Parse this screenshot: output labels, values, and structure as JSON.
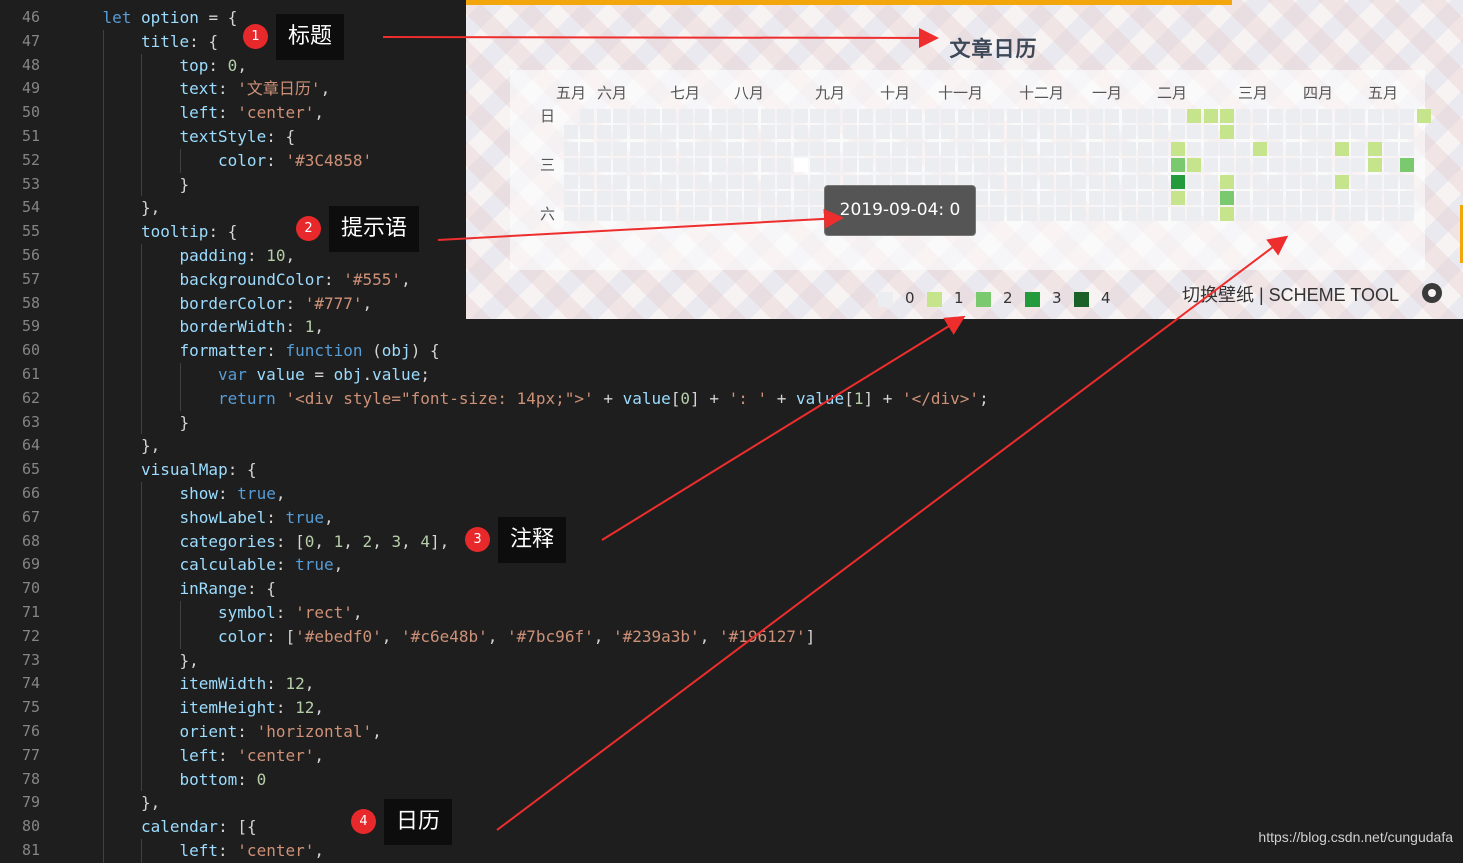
{
  "editor": {
    "lines": [
      {
        "n": "46",
        "indent": 1,
        "tokens": [
          [
            "kw",
            "let "
          ],
          [
            "var",
            "option"
          ],
          [
            "plain",
            " = {"
          ]
        ]
      },
      {
        "n": "47",
        "indent": 2,
        "tokens": [
          [
            "prop",
            "title"
          ],
          [
            "plain",
            ": {"
          ]
        ]
      },
      {
        "n": "48",
        "indent": 3,
        "tokens": [
          [
            "prop",
            "top"
          ],
          [
            "plain",
            ": "
          ],
          [
            "num",
            "0"
          ],
          [
            "plain",
            ","
          ]
        ]
      },
      {
        "n": "49",
        "indent": 3,
        "tokens": [
          [
            "prop",
            "text"
          ],
          [
            "plain",
            ": "
          ],
          [
            "str",
            "'文章日历'"
          ],
          [
            "plain",
            ","
          ]
        ]
      },
      {
        "n": "50",
        "indent": 3,
        "tokens": [
          [
            "prop",
            "left"
          ],
          [
            "plain",
            ": "
          ],
          [
            "str",
            "'center'"
          ],
          [
            "plain",
            ","
          ]
        ]
      },
      {
        "n": "51",
        "indent": 3,
        "tokens": [
          [
            "prop",
            "textStyle"
          ],
          [
            "plain",
            ": {"
          ]
        ]
      },
      {
        "n": "52",
        "indent": 4,
        "tokens": [
          [
            "prop",
            "color"
          ],
          [
            "plain",
            ": "
          ],
          [
            "str",
            "'#3C4858'"
          ]
        ]
      },
      {
        "n": "53",
        "indent": 3,
        "tokens": [
          [
            "plain",
            "}"
          ]
        ]
      },
      {
        "n": "54",
        "indent": 2,
        "tokens": [
          [
            "plain",
            "},"
          ]
        ]
      },
      {
        "n": "55",
        "indent": 2,
        "tokens": [
          [
            "prop",
            "tooltip"
          ],
          [
            "plain",
            ": {"
          ]
        ]
      },
      {
        "n": "56",
        "indent": 3,
        "tokens": [
          [
            "prop",
            "padding"
          ],
          [
            "plain",
            ": "
          ],
          [
            "num",
            "10"
          ],
          [
            "plain",
            ","
          ]
        ]
      },
      {
        "n": "57",
        "indent": 3,
        "tokens": [
          [
            "prop",
            "backgroundColor"
          ],
          [
            "plain",
            ": "
          ],
          [
            "str",
            "'#555'"
          ],
          [
            "plain",
            ","
          ]
        ]
      },
      {
        "n": "58",
        "indent": 3,
        "tokens": [
          [
            "prop",
            "borderColor"
          ],
          [
            "plain",
            ": "
          ],
          [
            "str",
            "'#777'"
          ],
          [
            "plain",
            ","
          ]
        ]
      },
      {
        "n": "59",
        "indent": 3,
        "tokens": [
          [
            "prop",
            "borderWidth"
          ],
          [
            "plain",
            ": "
          ],
          [
            "num",
            "1"
          ],
          [
            "plain",
            ","
          ]
        ]
      },
      {
        "n": "60",
        "indent": 3,
        "tokens": [
          [
            "prop",
            "formatter"
          ],
          [
            "plain",
            ": "
          ],
          [
            "kw",
            "function"
          ],
          [
            "plain",
            " ("
          ],
          [
            "var",
            "obj"
          ],
          [
            "plain",
            ") {"
          ]
        ]
      },
      {
        "n": "61",
        "indent": 4,
        "tokens": [
          [
            "kw",
            "var "
          ],
          [
            "var",
            "value"
          ],
          [
            "plain",
            " = "
          ],
          [
            "var",
            "obj"
          ],
          [
            "plain",
            "."
          ],
          [
            "var",
            "value"
          ],
          [
            "plain",
            ";"
          ]
        ]
      },
      {
        "n": "62",
        "indent": 4,
        "tokens": [
          [
            "kw",
            "return "
          ],
          [
            "str",
            "'<div style=\"font-size: 14px;\">'"
          ],
          [
            "plain",
            " + "
          ],
          [
            "var",
            "value"
          ],
          [
            "plain",
            "["
          ],
          [
            "num",
            "0"
          ],
          [
            "plain",
            "] + "
          ],
          [
            "str",
            "': '"
          ],
          [
            "plain",
            " + "
          ],
          [
            "var",
            "value"
          ],
          [
            "plain",
            "["
          ],
          [
            "num",
            "1"
          ],
          [
            "plain",
            "] + "
          ],
          [
            "str",
            "'</div>'"
          ],
          [
            "plain",
            ";"
          ]
        ]
      },
      {
        "n": "63",
        "indent": 3,
        "tokens": [
          [
            "plain",
            "}"
          ]
        ]
      },
      {
        "n": "64",
        "indent": 2,
        "tokens": [
          [
            "plain",
            "},"
          ]
        ]
      },
      {
        "n": "65",
        "indent": 2,
        "tokens": [
          [
            "prop",
            "visualMap"
          ],
          [
            "plain",
            ": {"
          ]
        ]
      },
      {
        "n": "66",
        "indent": 3,
        "tokens": [
          [
            "prop",
            "show"
          ],
          [
            "plain",
            ": "
          ],
          [
            "kw",
            "true"
          ],
          [
            "plain",
            ","
          ]
        ]
      },
      {
        "n": "67",
        "indent": 3,
        "tokens": [
          [
            "prop",
            "showLabel"
          ],
          [
            "plain",
            ": "
          ],
          [
            "kw",
            "true"
          ],
          [
            "plain",
            ","
          ]
        ]
      },
      {
        "n": "68",
        "indent": 3,
        "tokens": [
          [
            "prop",
            "categories"
          ],
          [
            "plain",
            ": ["
          ],
          [
            "num",
            "0"
          ],
          [
            "plain",
            ", "
          ],
          [
            "num",
            "1"
          ],
          [
            "plain",
            ", "
          ],
          [
            "num",
            "2"
          ],
          [
            "plain",
            ", "
          ],
          [
            "num",
            "3"
          ],
          [
            "plain",
            ", "
          ],
          [
            "num",
            "4"
          ],
          [
            "plain",
            "],"
          ]
        ]
      },
      {
        "n": "69",
        "indent": 3,
        "tokens": [
          [
            "prop",
            "calculable"
          ],
          [
            "plain",
            ": "
          ],
          [
            "kw",
            "true"
          ],
          [
            "plain",
            ","
          ]
        ]
      },
      {
        "n": "70",
        "indent": 3,
        "tokens": [
          [
            "prop",
            "inRange"
          ],
          [
            "plain",
            ": {"
          ]
        ]
      },
      {
        "n": "71",
        "indent": 4,
        "tokens": [
          [
            "prop",
            "symbol"
          ],
          [
            "plain",
            ": "
          ],
          [
            "str",
            "'rect'"
          ],
          [
            "plain",
            ","
          ]
        ]
      },
      {
        "n": "72",
        "indent": 4,
        "tokens": [
          [
            "prop",
            "color"
          ],
          [
            "plain",
            ": ["
          ],
          [
            "str",
            "'#ebedf0'"
          ],
          [
            "plain",
            ", "
          ],
          [
            "str",
            "'#c6e48b'"
          ],
          [
            "plain",
            ", "
          ],
          [
            "str",
            "'#7bc96f'"
          ],
          [
            "plain",
            ", "
          ],
          [
            "str",
            "'#239a3b'"
          ],
          [
            "plain",
            ", "
          ],
          [
            "str",
            "'#196127'"
          ],
          [
            "plain",
            "]"
          ]
        ]
      },
      {
        "n": "73",
        "indent": 3,
        "tokens": [
          [
            "plain",
            "},"
          ]
        ]
      },
      {
        "n": "74",
        "indent": 3,
        "tokens": [
          [
            "prop",
            "itemWidth"
          ],
          [
            "plain",
            ": "
          ],
          [
            "num",
            "12"
          ],
          [
            "plain",
            ","
          ]
        ]
      },
      {
        "n": "75",
        "indent": 3,
        "tokens": [
          [
            "prop",
            "itemHeight"
          ],
          [
            "plain",
            ": "
          ],
          [
            "num",
            "12"
          ],
          [
            "plain",
            ","
          ]
        ]
      },
      {
        "n": "76",
        "indent": 3,
        "tokens": [
          [
            "prop",
            "orient"
          ],
          [
            "plain",
            ": "
          ],
          [
            "str",
            "'horizontal'"
          ],
          [
            "plain",
            ","
          ]
        ]
      },
      {
        "n": "77",
        "indent": 3,
        "tokens": [
          [
            "prop",
            "left"
          ],
          [
            "plain",
            ": "
          ],
          [
            "str",
            "'center'"
          ],
          [
            "plain",
            ","
          ]
        ]
      },
      {
        "n": "78",
        "indent": 3,
        "tokens": [
          [
            "prop",
            "bottom"
          ],
          [
            "plain",
            ": "
          ],
          [
            "num",
            "0"
          ]
        ]
      },
      {
        "n": "79",
        "indent": 2,
        "tokens": [
          [
            "plain",
            "},"
          ]
        ]
      },
      {
        "n": "80",
        "indent": 2,
        "tokens": [
          [
            "prop",
            "calendar"
          ],
          [
            "plain",
            ": [{"
          ]
        ]
      },
      {
        "n": "81",
        "indent": 3,
        "tokens": [
          [
            "prop",
            "left"
          ],
          [
            "plain",
            ": "
          ],
          [
            "str",
            "'center'"
          ],
          [
            "plain",
            ","
          ]
        ]
      }
    ]
  },
  "calendar": {
    "title": "文章日历",
    "months": [
      "五月",
      "六月",
      "七月",
      "八月",
      "九月",
      "十月",
      "十一月",
      "十二月",
      "一月",
      "二月",
      "三月",
      "四月",
      "五月"
    ],
    "weekdays": [
      "日",
      "三",
      "六"
    ],
    "colors": [
      "#ebedf0",
      "#c6e48b",
      "#7bc96f",
      "#239a3b",
      "#196127"
    ],
    "legend_labels": [
      "0",
      "1",
      "2",
      "3",
      "4"
    ],
    "tooltip": "2019-09-04:  0",
    "scheme_tool": "切换壁纸 | SCHEME TOOL",
    "active": [
      [
        38,
        0,
        1
      ],
      [
        39,
        0,
        1
      ],
      [
        40,
        0,
        1
      ],
      [
        52,
        0,
        1
      ],
      [
        40,
        1,
        1
      ],
      [
        37,
        2,
        1
      ],
      [
        42,
        2,
        1
      ],
      [
        47,
        2,
        1
      ],
      [
        49,
        2,
        1
      ],
      [
        37,
        3,
        2
      ],
      [
        38,
        3,
        1
      ],
      [
        49,
        3,
        1
      ],
      [
        51,
        3,
        2
      ],
      [
        37,
        4,
        3
      ],
      [
        40,
        4,
        1
      ],
      [
        47,
        4,
        1
      ],
      [
        37,
        5,
        1
      ],
      [
        40,
        5,
        2
      ],
      [
        40,
        6,
        1
      ]
    ],
    "blank_cells": [
      [
        14,
        3
      ]
    ]
  },
  "callouts": [
    {
      "num": "1",
      "label": "标题"
    },
    {
      "num": "2",
      "label": "提示语"
    },
    {
      "num": "3",
      "label": "注释"
    },
    {
      "num": "4",
      "label": "日历"
    }
  ],
  "watermark": "https://blog.csdn.net/cungudafa"
}
